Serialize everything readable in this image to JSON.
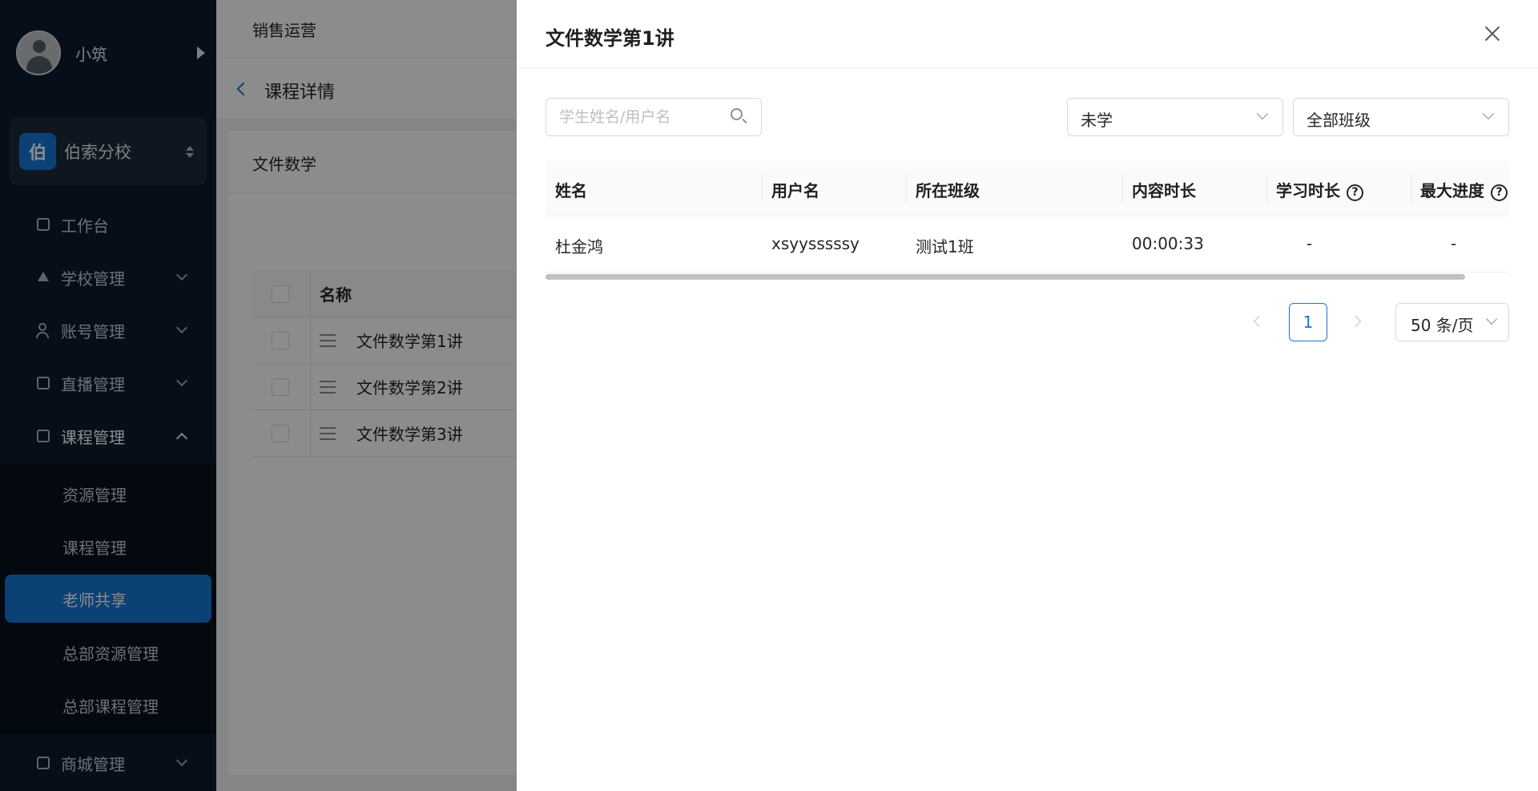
{
  "sidebar": {
    "user_name": "小筑",
    "school_logo_char": "伯",
    "school_name": "伯索分校",
    "menu": [
      {
        "label": "工作台",
        "icon": "dashboard-icon"
      },
      {
        "label": "学校管理",
        "icon": "school-icon"
      },
      {
        "label": "账号管理",
        "icon": "user-icon"
      },
      {
        "label": "直播管理",
        "icon": "live-icon"
      },
      {
        "label": "课程管理",
        "icon": "book-icon"
      },
      {
        "label": "商城管理",
        "icon": "shop-icon"
      }
    ],
    "submenu": [
      {
        "label": "资源管理"
      },
      {
        "label": "课程管理"
      },
      {
        "label": "老师共享"
      },
      {
        "label": "总部资源管理"
      },
      {
        "label": "总部课程管理"
      }
    ]
  },
  "topbar": {
    "label": "销售运营"
  },
  "breadcrumb": {
    "title": "课程详情"
  },
  "course_card": {
    "title": "文件数学",
    "table_header_name": "名称",
    "lessons": [
      "文件数学第1讲",
      "文件数学第2讲",
      "文件数学第3讲"
    ]
  },
  "drawer": {
    "title": "文件数学第1讲",
    "search_placeholder": "学生姓名/用户名",
    "status_filter": "未学",
    "class_filter": "全部班级",
    "columns": [
      "姓名",
      "用户名",
      "所在班级",
      "内容时长",
      "学习时长",
      "最大进度"
    ],
    "rows": [
      {
        "name": "杜金鸿",
        "username": "xsyysssssy",
        "class": "测试1班",
        "content_duration": "00:00:33",
        "study_duration": "-",
        "max_progress": "-"
      }
    ],
    "pagination": {
      "current_page": "1",
      "page_size": "50 条/页"
    }
  },
  "colors": {
    "primary": "#1677d6",
    "sidebar_bg": "#0b1c2e"
  }
}
